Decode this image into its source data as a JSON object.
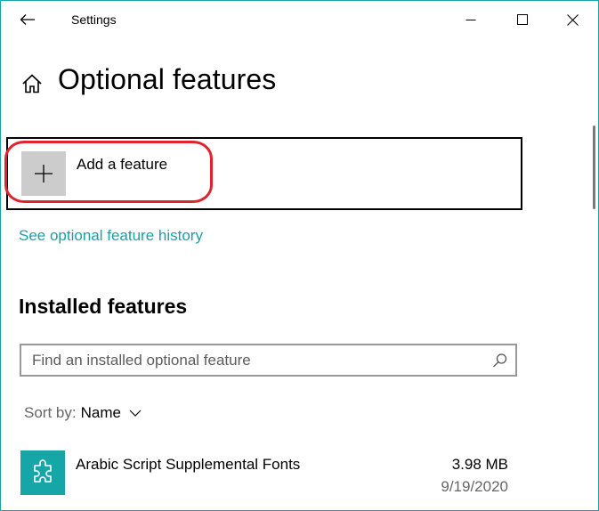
{
  "window": {
    "title": "Settings"
  },
  "header": {
    "page_title": "Optional features"
  },
  "add_feature": {
    "label": "Add a feature"
  },
  "history_link": {
    "label": "See optional feature history"
  },
  "installed": {
    "section_title": "Installed features",
    "search": {
      "placeholder": "Find an installed optional feature",
      "value": ""
    },
    "sort": {
      "label": "Sort by:",
      "value": "Name"
    },
    "items": [
      {
        "name": "Arabic Script Supplemental Fonts",
        "size": "3.98 MB",
        "date": "9/19/2020",
        "icon": "puzzle-icon"
      }
    ]
  },
  "colors": {
    "accent": "#1a9fa5",
    "feature_icon_bg": "#16a6a8",
    "highlight_oval": "#e0232e",
    "window_border": "#1aa3a3"
  }
}
